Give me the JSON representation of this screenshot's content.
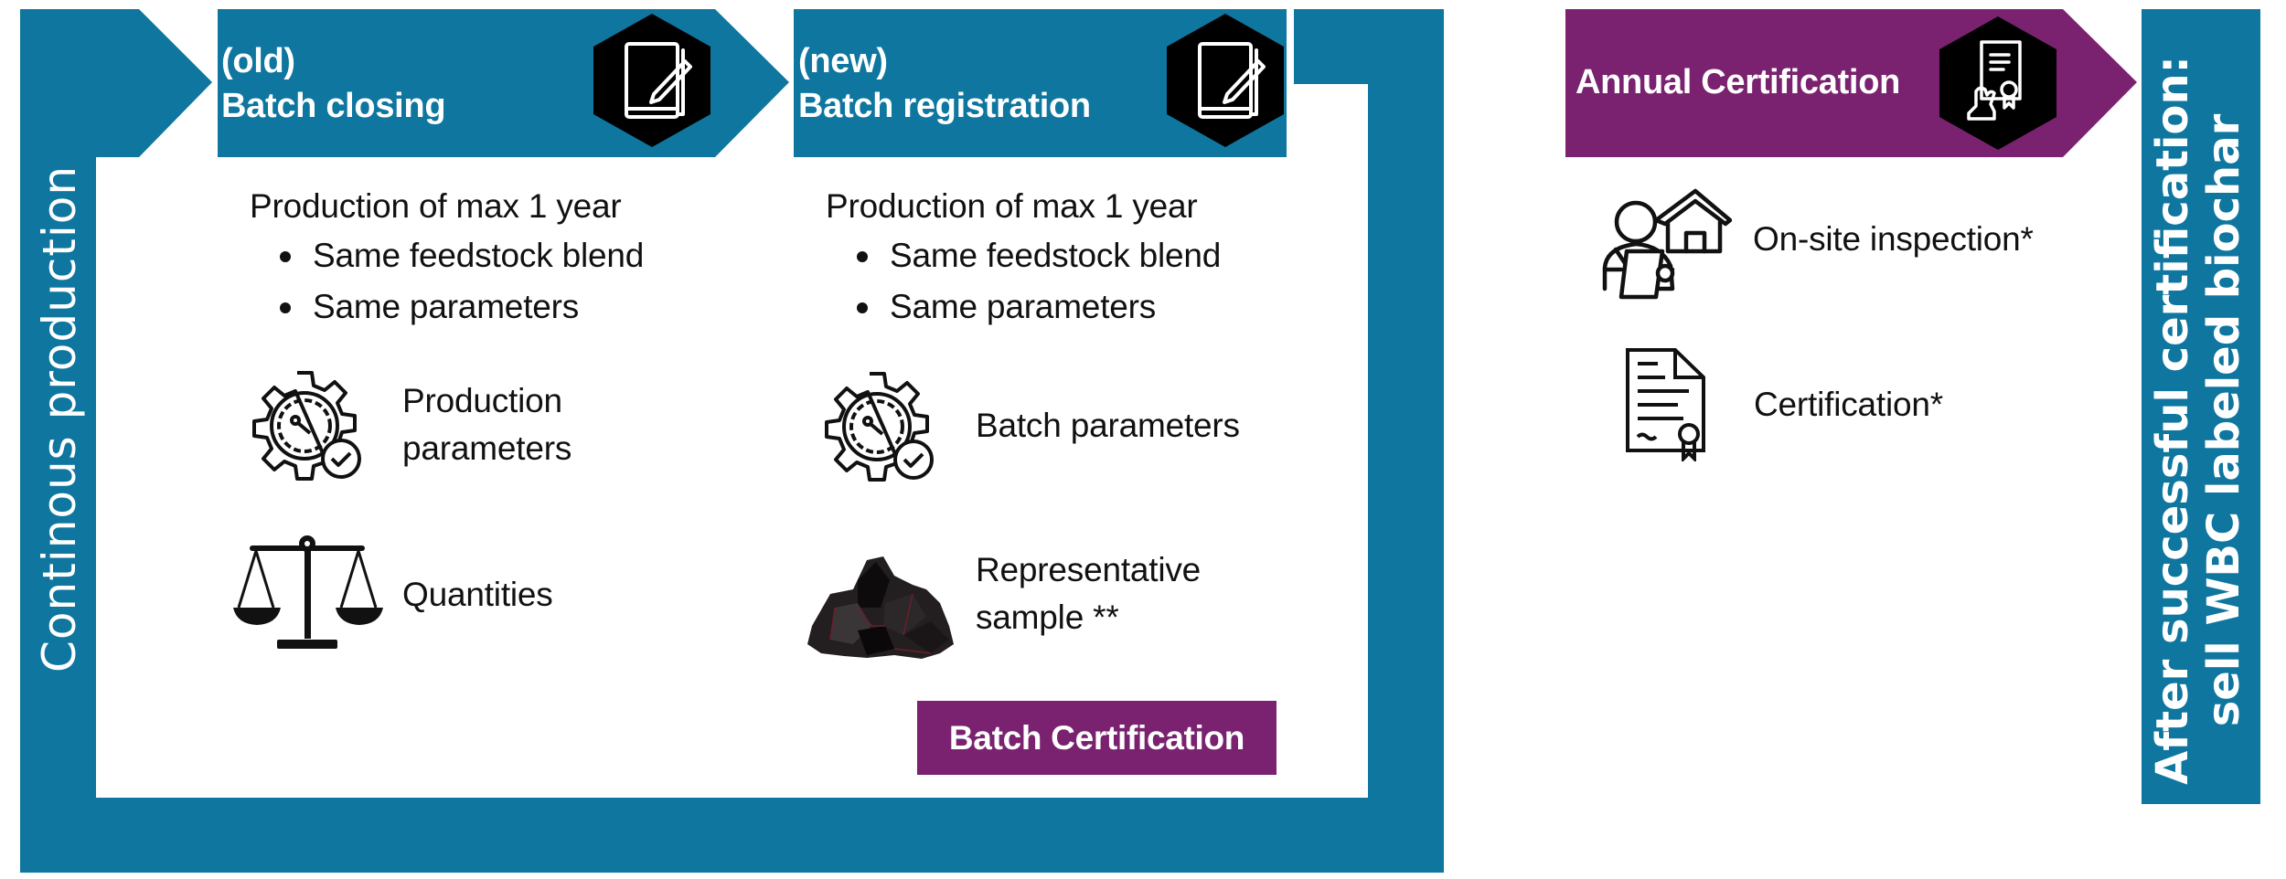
{
  "colors": {
    "primary_blue": "#0e769f",
    "accent_purple": "#7a2270",
    "icon_badge": "#000000",
    "text_dark": "#111111",
    "text_light": "#ffffff"
  },
  "side_label": "Continous production",
  "stages": [
    {
      "tag": "(old)",
      "title": "Batch closing",
      "icon": "notebook-pen-icon",
      "heading": "Production of max 1 year",
      "bullets": [
        "Same feedstock blend",
        "Same parameters"
      ],
      "items": [
        {
          "icon": "gear-gauge-check-icon",
          "label_line1": "Production",
          "label_line2": "parameters"
        },
        {
          "icon": "balance-scale-icon",
          "label_line1": "Quantities",
          "label_line2": ""
        }
      ]
    },
    {
      "tag": "(new)",
      "title": "Batch registration",
      "icon": "notebook-pen-icon",
      "heading": "Production of max 1 year",
      "bullets": [
        "Same feedstock blend",
        "Same parameters"
      ],
      "items": [
        {
          "icon": "gear-gauge-check-icon",
          "label_line1": "Batch parameters",
          "label_line2": ""
        },
        {
          "icon": "biochar-pile-icon",
          "label_line1": "Representative",
          "label_line2": "sample **"
        }
      ],
      "certification_label": "Batch Certification"
    }
  ],
  "annual": {
    "title": "Annual Certification",
    "icon": "certificate-in-hand-icon",
    "items": [
      {
        "icon": "inspector-house-icon",
        "label": "On-site inspection*"
      },
      {
        "icon": "certificate-document-icon",
        "label": "Certification*"
      }
    ]
  },
  "outcome": {
    "line1": "After successful certification:",
    "line2": "sell WBC labeled biochar"
  }
}
